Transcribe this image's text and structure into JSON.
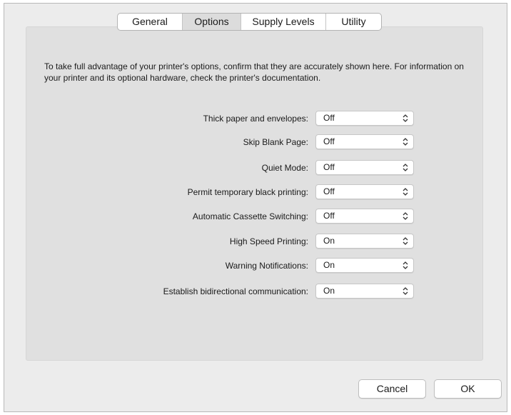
{
  "tabs": [
    {
      "label": "General"
    },
    {
      "label": "Options"
    },
    {
      "label": "Supply Levels"
    },
    {
      "label": "Utility"
    }
  ],
  "active_tab": "Options",
  "description": "To take full advantage of your printer's options, confirm that they are accurately shown here. For information on your printer and its optional hardware, check the printer's documentation.",
  "options": [
    {
      "label": "Thick paper and envelopes:",
      "value": "Off"
    },
    {
      "label": "Skip Blank Page:",
      "value": "Off"
    },
    {
      "label": "Quiet Mode:",
      "value": "Off"
    },
    {
      "label": "Permit temporary black printing:",
      "value": "Off"
    },
    {
      "label": "Automatic Cassette Switching:",
      "value": "Off"
    },
    {
      "label": "High Speed Printing:",
      "value": "On"
    },
    {
      "label": "Warning Notifications:",
      "value": "On"
    },
    {
      "label": "Establish bidirectional communication:",
      "value": "On"
    }
  ],
  "buttons": {
    "cancel": "Cancel",
    "ok": "OK"
  }
}
